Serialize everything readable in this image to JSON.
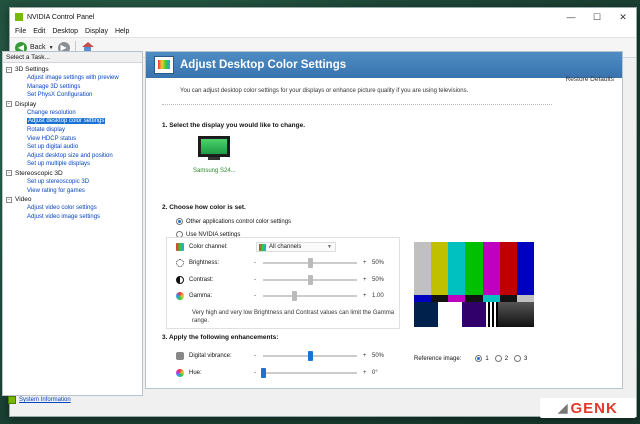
{
  "window": {
    "title": "NVIDIA Control Panel",
    "controls": [
      "—",
      "☐",
      "✕"
    ]
  },
  "menu": [
    "File",
    "Edit",
    "Desktop",
    "Display",
    "Help"
  ],
  "toolbar": {
    "back_label": "Back"
  },
  "task_panel": {
    "heading": "Select a Task...",
    "categories": [
      {
        "label": "3D Settings",
        "items": [
          "Adjust image settings with preview",
          "Manage 3D settings",
          "Set PhysX Configuration"
        ]
      },
      {
        "label": "Display",
        "items": [
          "Change resolution",
          "Adjust desktop color settings",
          "Rotate display",
          "View HDCP status",
          "Set up digital audio",
          "Adjust desktop size and position",
          "Set up multiple displays"
        ]
      },
      {
        "label": "Stereoscopic 3D",
        "items": [
          "Set up stereoscopic 3D",
          "View rating for games"
        ]
      },
      {
        "label": "Video",
        "items": [
          "Adjust video color settings",
          "Adjust video image settings"
        ]
      }
    ],
    "selected_item": "Adjust desktop color settings"
  },
  "page": {
    "title": "Adjust Desktop Color Settings",
    "restore_label": "Restore Defaults",
    "description": "You can adjust desktop color settings for your displays or enhance picture quality if you are using televisions.",
    "section1": "1. Select the display you would like to change.",
    "display_name": "Samsung S24...",
    "section2": "2. Choose how color is set.",
    "radio_other": "Other applications control color settings",
    "radio_nvidia": "Use NVIDIA settings",
    "color_channel_label": "Color channel:",
    "color_channel_value": "All channels",
    "brightness_label": "Brightness:",
    "brightness_value": "50%",
    "contrast_label": "Contrast:",
    "contrast_value": "50%",
    "gamma_label": "Gamma:",
    "gamma_value": "1.00",
    "note": "Very high and very low Brightness and Contrast values can limit the Gamma range.",
    "section3": "3. Apply the following enhancements:",
    "vibrance_label": "Digital vibrance:",
    "vibrance_value": "50%",
    "hue_label": "Hue:",
    "hue_value": "0°",
    "minus": "-",
    "plus": "+",
    "reference_label": "Reference image:",
    "reference_options": [
      "1",
      "2",
      "3"
    ]
  },
  "levels": {
    "brightness": 0.5,
    "contrast": 0.5,
    "gamma": 0.33,
    "vibrance": 0.5,
    "hue": 0.0
  },
  "footer": {
    "system_info": "System Information"
  },
  "watermark": "GENK",
  "colors": {
    "accent": "#1a73d4",
    "banner": "#3f7eb8",
    "nvidia_green": "#76b900"
  }
}
